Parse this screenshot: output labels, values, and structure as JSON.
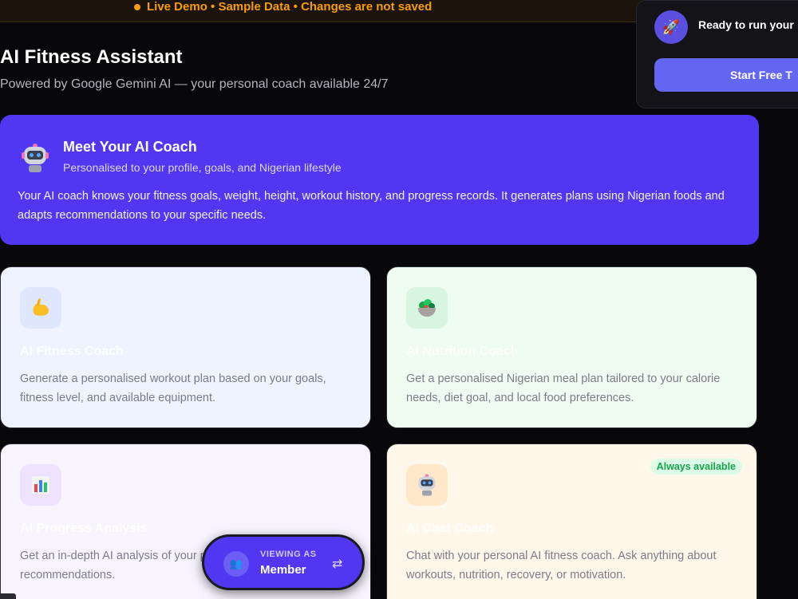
{
  "banner": {
    "text": "Live Demo • Sample Data • Changes are not saved"
  },
  "header": {
    "title": "AI Fitness Assistant",
    "subtitle": "Powered by Google Gemini AI — your personal coach available 24/7"
  },
  "upgrade": {
    "icon": "rocket-icon",
    "text": "Ready to run your",
    "button_label": "Start Free T"
  },
  "hero": {
    "icon": "robot-icon",
    "title": "Meet Your AI Coach",
    "subtitle": "Personalised to your profile, goals, and Nigerian lifestyle",
    "description": "Your AI coach knows your fitness goals, weight, height, workout history, and progress records. It generates plans using Nigerian foods and adapts recommendations to your specific needs."
  },
  "tools": [
    {
      "icon": "flexed-biceps-icon",
      "title": "AI Fitness Coach",
      "description": "Generate a personalised workout plan based on your goals, fitness level, and available equipment."
    },
    {
      "icon": "salad-bowl-icon",
      "title": "AI Nutrition Coach",
      "description": "Get a personalised Nigerian meal plan tailored to your calorie needs, diet goal, and local food preferences."
    },
    {
      "icon": "bar-chart-icon",
      "title": "AI Progress Analysis",
      "description": "Get an in-depth AI analysis of your progress and personalised recommendations."
    },
    {
      "icon": "robot-icon",
      "title": "AI Chat Coach",
      "description": "Chat with your personal AI fitness coach. Ask anything about workouts, nutrition, recovery, or motivation.",
      "badge": "Always available"
    }
  ],
  "role_switcher": {
    "label": "VIEWING AS",
    "value": "Member",
    "icon": "users-icon",
    "swap_icon": "swap-arrows-icon"
  },
  "colors": {
    "accent": "#5137f2",
    "banner": "#f59e0b",
    "badge": "#16a34a"
  }
}
